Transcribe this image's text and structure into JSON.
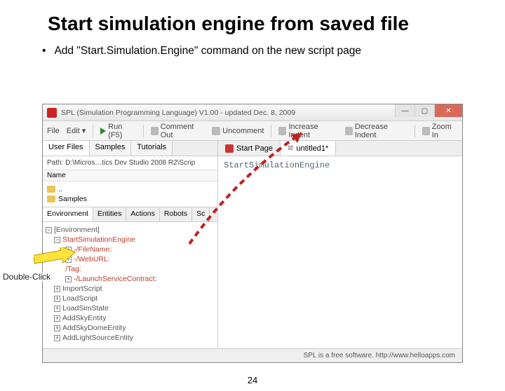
{
  "slide": {
    "title": "Start simulation engine from saved file",
    "bullet": "Add \"Start.Simulation.Engine\" command on the new script page",
    "page_number": "24"
  },
  "annotation": {
    "double_click": "Double-Click"
  },
  "window": {
    "title": "SPL (Simulation Programming Language) V1.00 - updated Dec. 8, 2009",
    "toolbar": {
      "file": "File",
      "edit": "Edit",
      "run": "Run (F5)",
      "comment_out": "Comment Out",
      "uncomment": "Uncomment",
      "increase_indent": "Increase Indent",
      "decrease_indent": "Decrease Indent",
      "zoom_in": "Zoom In"
    },
    "left": {
      "tabs": {
        "user_files": "User Files",
        "samples": "Samples",
        "tutorials": "Tutorials"
      },
      "path": "Path: D:\\Micros…tics Dev Studio 2008 R2\\Scrip",
      "name_header": "Name",
      "files": {
        "up": "..",
        "samples_folder": "Samples"
      },
      "env_tabs": {
        "environment": "Environment",
        "entities": "Entities",
        "actions": "Actions",
        "robots": "Robots",
        "sc": "Sc"
      },
      "tree": {
        "root": "[Environment]",
        "start_sim": "StartSimulationEngine",
        "filename": "-/FileName:",
        "weburl": "-/WebURL:",
        "tag": "/Tag:",
        "launch_service": "-/LaunchServiceContract:",
        "import_script": "ImportScript",
        "load_script": "LoadScript",
        "load_sim_state": "LoadSimState",
        "add_sky": "AddSkyEntity",
        "add_sky_dome": "AddSkyDomeEntity",
        "add_light_source": "AddLightSourceEntity"
      }
    },
    "right": {
      "tabs": {
        "start_page": "Start Page",
        "untitled": "untitled1*"
      },
      "editor_line": "StartSimulationEngine"
    },
    "statusbar": "SPL is a free software. http://www.helloapps.com"
  }
}
